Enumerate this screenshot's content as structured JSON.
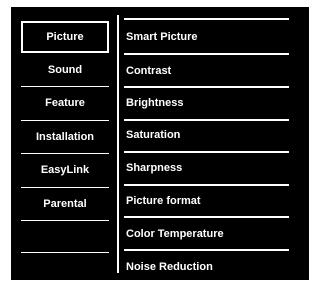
{
  "menu": {
    "left_items": [
      {
        "label": "Picture",
        "selected": true
      },
      {
        "label": "Sound",
        "selected": false
      },
      {
        "label": "Feature",
        "selected": false
      },
      {
        "label": "Installation",
        "selected": false
      },
      {
        "label": "EasyLink",
        "selected": false
      },
      {
        "label": "Parental",
        "selected": false
      }
    ],
    "right_items": [
      {
        "label": "Smart Picture"
      },
      {
        "label": "Contrast"
      },
      {
        "label": "Brightness"
      },
      {
        "label": "Saturation"
      },
      {
        "label": "Sharpness"
      },
      {
        "label": "Picture format"
      },
      {
        "label": "Color Temperature"
      },
      {
        "label": "Noise Reduction"
      }
    ]
  },
  "colors": {
    "background": "#000000",
    "foreground": "#ffffff"
  }
}
